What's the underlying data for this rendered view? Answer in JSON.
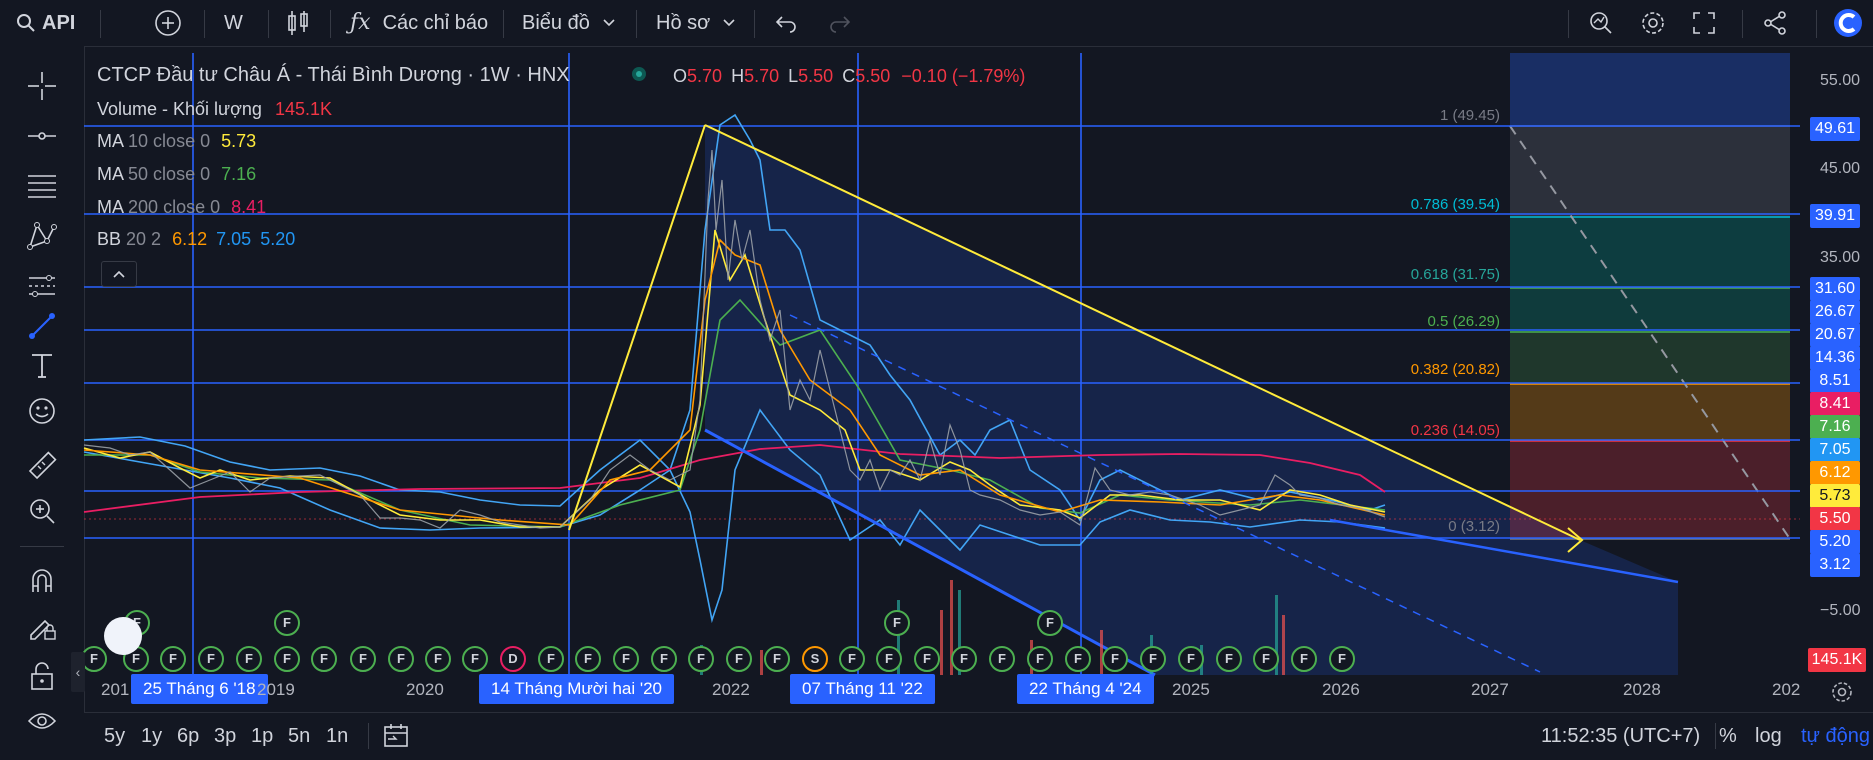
{
  "toolbar": {
    "search_label": "API",
    "interval": "W",
    "indicators_label": "Các chỉ báo",
    "chart_type_label": "Biểu đồ",
    "profile_label": "Hồ sơ"
  },
  "legend": {
    "title": "CTCP Đầu tư Châu Á - Thái Bình Dương · 1W · HNX",
    "o_label": "O",
    "o_val": "5.70",
    "h_label": "H",
    "h_val": "5.70",
    "l_label": "L",
    "l_val": "5.50",
    "c_label": "C",
    "c_val": "5.50",
    "change": "−0.10 (−1.79%)",
    "volume_label": "Volume - Khối lượng",
    "volume_val": "145.1K",
    "ma10_label": "MA",
    "ma10_params": "10 close 0",
    "ma10_val": "5.73",
    "ma50_label": "MA",
    "ma50_params": "50 close 0",
    "ma50_val": "7.16",
    "ma200_label": "MA",
    "ma200_params": "200 close 0",
    "ma200_val": "8.41",
    "bb_label": "BB",
    "bb_params": "20 2",
    "bb_v1": "6.12",
    "bb_v2": "7.05",
    "bb_v3": "5.20"
  },
  "fib_levels": {
    "l1": "1 (49.45)",
    "l786": "0.786 (39.54)",
    "l618": "0.618 (31.75)",
    "l5": "0.5 (26.29)",
    "l382": "0.382 (20.82)",
    "l236": "0.236 (14.05)",
    "l0": "0 (3.12)"
  },
  "price_ticks": [
    "55.00",
    "45.00",
    "35.00",
    "−5.00"
  ],
  "price_labels": {
    "p1": "49.61",
    "p2": "39.91",
    "p3": "31.60",
    "p4": "26.67",
    "p5": "20.67",
    "p6": "14.36",
    "p7": "8.51",
    "p8": "8.41",
    "p9": "7.16",
    "p10": "7.05",
    "p11": "6.12",
    "p12": "5.73",
    "p13": "5.50",
    "p14": "5.20",
    "p15": "3.12",
    "vol": "145.1K"
  },
  "x_axis": {
    "y2019": "2019",
    "y2020": "2020",
    "y2022": "2022",
    "y2025": "2025",
    "y2026": "2026",
    "y2027": "2027",
    "y2028": "2028",
    "y202": "202",
    "y201": "201",
    "hl1": "25 Tháng 6 '18",
    "hl2": "14 Tháng Mười hai '20",
    "hl3": "07 Tháng 11 '22",
    "hl4": "22 Tháng 4 '24"
  },
  "bottom": {
    "r5y": "5y",
    "r1y": "1y",
    "r6p": "6p",
    "r3p": "3p",
    "r1p": "1p",
    "r5n": "5n",
    "r1n": "1n",
    "time": "11:52:35 (UTC+7)",
    "pct": "%",
    "log": "log",
    "auto": "tự động"
  },
  "colors": {
    "accent": "#2962ff",
    "up": "#26a69a",
    "down": "#ef5350",
    "ma10": "#ffeb3b",
    "ma50": "#4caf50",
    "ma200": "#e91e63",
    "bb": "#2196f3",
    "trend": "#ffeb3b"
  },
  "icons": [
    "search-icon",
    "plus-icon",
    "candles-icon",
    "fx-icon",
    "undo-icon",
    "redo-icon",
    "alert-icon",
    "gear-icon",
    "fullscreen-icon",
    "share-icon",
    "logo-icon",
    "crosshair-icon",
    "line-icon",
    "fib-icon",
    "pattern-icon",
    "forecast-icon",
    "trendline-icon",
    "text-icon",
    "emoji-icon",
    "ruler-icon",
    "zoom-icon",
    "magnet-icon",
    "pencil-lock-icon",
    "lock-icon",
    "eye-icon"
  ]
}
